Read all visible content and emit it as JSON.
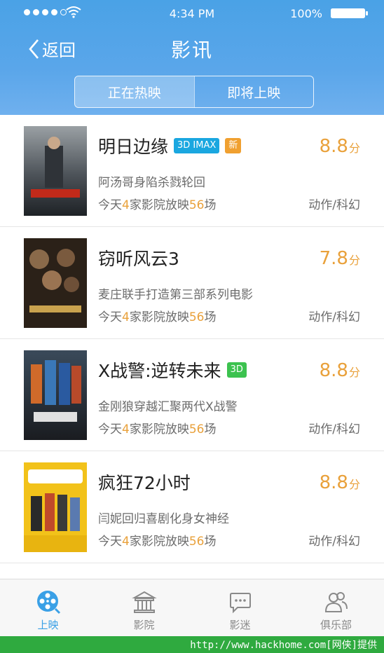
{
  "status_bar": {
    "time": "4:34 PM",
    "battery": "100%"
  },
  "nav": {
    "back_label": "返回",
    "title": "影讯"
  },
  "segments": [
    {
      "label": "正在热映",
      "active": true
    },
    {
      "label": "即将上映",
      "active": false
    }
  ],
  "movies": [
    {
      "title": "明日边缘",
      "tags": [
        {
          "text": "3D IMAX",
          "color": "#1aa7e0"
        },
        {
          "text": "新",
          "color": "#f0a030"
        }
      ],
      "score": "8.8",
      "score_unit": "分",
      "desc": "阿汤哥身陷杀戮轮回",
      "show_prefix": "今天",
      "cinemas": "4",
      "show_mid": "家影院放映",
      "sessions": "56",
      "show_suffix": "场",
      "genre": "动作/科幻",
      "poster_text": "明日边缘"
    },
    {
      "title": "窃听风云3",
      "tags": [],
      "score": "7.8",
      "score_unit": "分",
      "desc": "麦庄联手打造第三部系列电影",
      "show_prefix": "今天",
      "cinemas": "4",
      "show_mid": "家影院放映",
      "sessions": "56",
      "show_suffix": "场",
      "genre": "动作/科幻",
      "poster_text": "窃听风云"
    },
    {
      "title": "X战警:逆转未来",
      "tags": [
        {
          "text": "3D",
          "color": "#3cc24f"
        }
      ],
      "score": "8.8",
      "score_unit": "分",
      "desc": "金刚狼穿越汇聚两代X战警",
      "show_prefix": "今天",
      "cinemas": "4",
      "show_mid": "家影院放映",
      "sessions": "56",
      "show_suffix": "场",
      "genre": "动作/科幻",
      "poster_text": "X战警"
    },
    {
      "title": "疯狂72小时",
      "tags": [],
      "score": "8.8",
      "score_unit": "分",
      "desc": "闫妮回归喜剧化身女神经",
      "show_prefix": "今天",
      "cinemas": "4",
      "show_mid": "家影院放映",
      "sessions": "56",
      "show_suffix": "场",
      "genre": "动作/科幻",
      "poster_text": "疯狂72小时"
    }
  ],
  "tabbar": [
    {
      "label": "上映",
      "icon": "film-reel-icon",
      "active": true
    },
    {
      "label": "影院",
      "icon": "cinema-building-icon",
      "active": false
    },
    {
      "label": "影迷",
      "icon": "chat-bubble-icon",
      "active": false
    },
    {
      "label": "俱乐部",
      "icon": "people-icon",
      "active": false
    }
  ],
  "footer": {
    "text": "http://www.hackhome.com[网侠]提供"
  },
  "colors": {
    "header": "#4aa2e6",
    "accent": "#e9a13b",
    "active_tab": "#3aa0e6",
    "footer": "#2faa3f"
  }
}
